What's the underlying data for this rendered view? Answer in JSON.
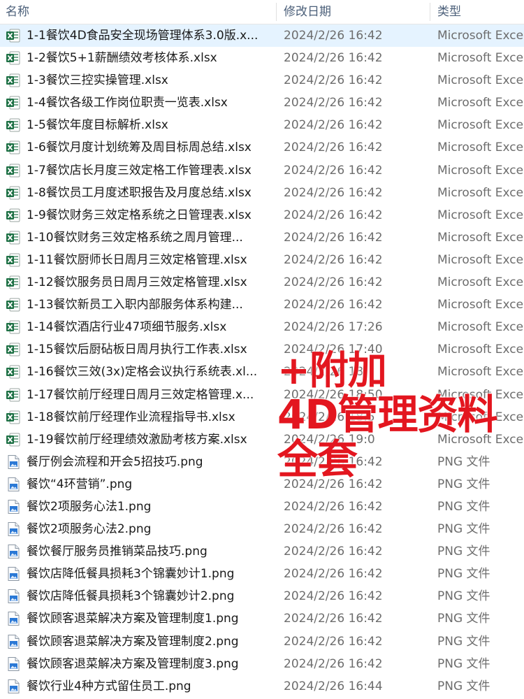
{
  "header": {
    "col_name": "名称",
    "col_date": "修改日期",
    "col_type": "类型"
  },
  "files": [
    {
      "name": "1-1餐饮4D食品安全现场管理体系3.0版.x...",
      "date": "2024/2/26 16:42",
      "type": "Microsoft Exce",
      "icon": "excel-file-icon"
    },
    {
      "name": "1-2餐饮5+1薪酬绩效考核体系.xlsx",
      "date": "2024/2/26 16:42",
      "type": "Microsoft Exce",
      "icon": "excel-file-icon"
    },
    {
      "name": "1-3餐饮三控实操管理.xlsx",
      "date": "2024/2/26 16:42",
      "type": "Microsoft Exce",
      "icon": "excel-file-icon"
    },
    {
      "name": "1-4餐饮各级工作岗位职责一览表.xlsx",
      "date": "2024/2/26 16:42",
      "type": "Microsoft Exce",
      "icon": "excel-file-icon"
    },
    {
      "name": "1-5餐饮年度目标解析.xlsx",
      "date": "2024/2/26 16:42",
      "type": "Microsoft Exce",
      "icon": "excel-file-icon"
    },
    {
      "name": "1-6餐饮月度计划统筹及周目标周总结.xlsx",
      "date": "2024/2/26 16:42",
      "type": "Microsoft Exce",
      "icon": "excel-file-icon"
    },
    {
      "name": "1-7餐饮店长月度三效定格工作管理表.xlsx",
      "date": "2024/2/26 16:42",
      "type": "Microsoft Exce",
      "icon": "excel-file-icon"
    },
    {
      "name": "1-8餐饮员工月度述职报告及月度总结.xlsx",
      "date": "2024/2/26 16:42",
      "type": "Microsoft Exce",
      "icon": "excel-file-icon"
    },
    {
      "name": "1-9餐饮财务三效定格系统之日管理表.xlsx",
      "date": "2024/2/26 16:42",
      "type": "Microsoft Exce",
      "icon": "excel-file-icon"
    },
    {
      "name": "1-10餐饮财务三效定格系统之周月管理...",
      "date": "2024/2/26 16:42",
      "type": "Microsoft Exce",
      "icon": "excel-file-icon"
    },
    {
      "name": "1-11餐饮厨师长日周月三效定格管理.xlsx",
      "date": "2024/2/26 16:42",
      "type": "Microsoft Exce",
      "icon": "excel-file-icon"
    },
    {
      "name": "1-12餐饮服务员日周月三效定格管理.xlsx",
      "date": "2024/2/26 16:42",
      "type": "Microsoft Exce",
      "icon": "excel-file-icon"
    },
    {
      "name": "1-13餐饮新员工入职内部服务体系构建...",
      "date": "2024/2/26 16:42",
      "type": "Microsoft Exce",
      "icon": "excel-file-icon"
    },
    {
      "name": "1-14餐饮酒店行业47项细节服务.xlsx",
      "date": "2024/2/26 17:26",
      "type": "Microsoft Exce",
      "icon": "excel-file-icon"
    },
    {
      "name": "1-15餐饮后厨砧板日周月执行工作表.xlsx",
      "date": "2024/2/26 17:40",
      "type": "Microsoft Exce",
      "icon": "excel-file-icon"
    },
    {
      "name": "1-16餐饮三效(3x)定格会议执行系统表.xl...",
      "date": "2024/2/26 18:",
      "type": "Microsoft Exce",
      "icon": "excel-file-icon"
    },
    {
      "name": "1-17餐饮前厅经理日周月三效定格管理.x...",
      "date": "2024/2/26 18:50",
      "type": "Microsoft Exce",
      "icon": "excel-file-icon"
    },
    {
      "name": "1-18餐饮前厅经理作业流程指导书.xlsx",
      "date": "2024/2/26 18:5",
      "type": "Microsoft Exce",
      "icon": "excel-file-icon"
    },
    {
      "name": "1-19餐饮前厅经理绩效激励考核方案.xlsx",
      "date": "2024/2/26 19:0",
      "type": "Microsoft Exce",
      "icon": "excel-file-icon"
    },
    {
      "name": "餐厅例会流程和开会5招技巧.png",
      "date": "2024/2/26 16:42",
      "type": "PNG 文件",
      "icon": "image-file-icon"
    },
    {
      "name": "餐饮“4环营销”.png",
      "date": "2024/2/26 16:42",
      "type": "PNG 文件",
      "icon": "image-file-icon"
    },
    {
      "name": "餐饮2项服务心法1.png",
      "date": "2024/2/26 16:42",
      "type": "PNG 文件",
      "icon": "image-file-icon"
    },
    {
      "name": "餐饮2项服务心法2.png",
      "date": "2024/2/26 16:42",
      "type": "PNG 文件",
      "icon": "image-file-icon"
    },
    {
      "name": "餐饮餐厅服务员推销菜品技巧.png",
      "date": "2024/2/26 16:42",
      "type": "PNG 文件",
      "icon": "image-file-icon"
    },
    {
      "name": "餐饮店降低餐具损耗3个锦囊妙计1.png",
      "date": "2024/2/26 16:42",
      "type": "PNG 文件",
      "icon": "image-file-icon"
    },
    {
      "name": "餐饮店降低餐具损耗3个锦囊妙计2.png",
      "date": "2024/2/26 16:42",
      "type": "PNG 文件",
      "icon": "image-file-icon"
    },
    {
      "name": "餐饮顾客退菜解决方案及管理制度1.png",
      "date": "2024/2/26 16:42",
      "type": "PNG 文件",
      "icon": "image-file-icon"
    },
    {
      "name": "餐饮顾客退菜解决方案及管理制度2.png",
      "date": "2024/2/26 16:42",
      "type": "PNG 文件",
      "icon": "image-file-icon"
    },
    {
      "name": "餐饮顾客退菜解决方案及管理制度3.png",
      "date": "2024/2/26 16:42",
      "type": "PNG 文件",
      "icon": "image-file-icon"
    },
    {
      "name": "餐饮行业4种方式留住员工.png",
      "date": "2024/2/26 16:44",
      "type": "PNG 文件",
      "icon": "image-file-icon"
    }
  ],
  "overlay": {
    "line1": "+附加",
    "line2": "4D管理资料",
    "line3": "全套",
    "color": "#e3161f"
  },
  "colors": {
    "header_text": "#4c607a",
    "selected_row": "#e5f3ff",
    "excel_green": "#1e7145",
    "image_blue": "#2b79d6"
  }
}
